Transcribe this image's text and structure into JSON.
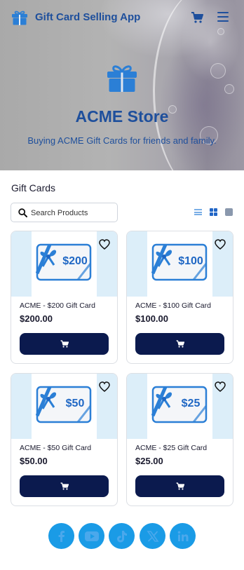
{
  "header": {
    "brand_title": "Gift Card Selling App",
    "brand_icon": "gift-icon",
    "cart_icon": "cart-icon",
    "menu_icon": "hamburger-menu-icon"
  },
  "hero": {
    "title": "ACME Store",
    "subtitle": "Buying ACME Gift Cards for friends and family.",
    "icon": "gift-icon"
  },
  "products_section": {
    "title": "Gift Cards",
    "search": {
      "placeholder": "Search Products",
      "value": ""
    },
    "view_modes": [
      "list-view-icon",
      "grid-view-icon",
      "card-view-icon"
    ],
    "selected_view": "grid-view-icon"
  },
  "products": [
    {
      "name": "ACME - $200 Gift Card",
      "price": "$200.00",
      "card_label": "$200"
    },
    {
      "name": "ACME - $100 Gift Card",
      "price": "$100.00",
      "card_label": "$100"
    },
    {
      "name": "ACME - $50 Gift Card",
      "price": "$50.00",
      "card_label": "$50"
    },
    {
      "name": "ACME - $25 Gift Card",
      "price": "$25.00",
      "card_label": "$25"
    }
  ],
  "social": [
    "facebook-icon",
    "youtube-icon",
    "tiktok-icon",
    "x-icon",
    "linkedin-icon"
  ],
  "colors": {
    "brand_blue": "#1e4f9c",
    "accent_blue": "#2b7fd6",
    "button_navy": "#0b1a4e",
    "social_blue": "#1a9be6",
    "image_bg": "#dceef9"
  }
}
